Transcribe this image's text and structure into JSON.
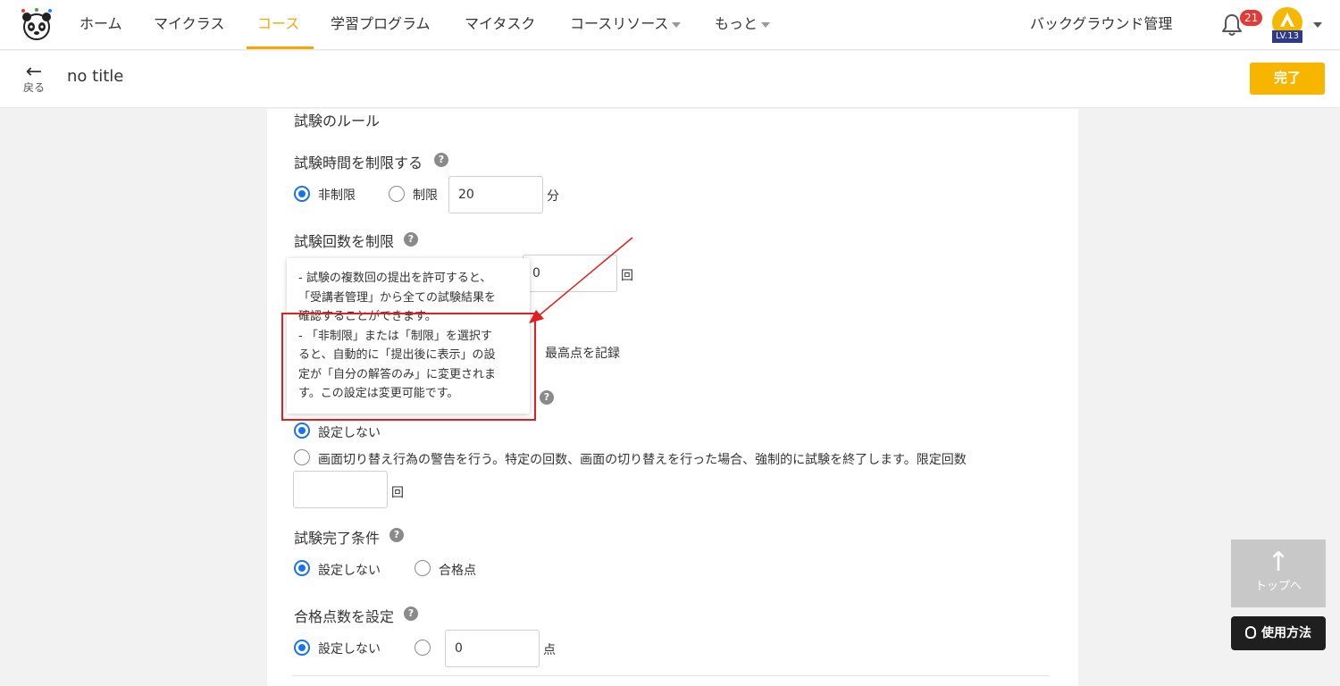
{
  "nav": {
    "items": [
      {
        "label": "ホーム"
      },
      {
        "label": "マイクラス"
      },
      {
        "label": "コース"
      },
      {
        "label": "学習プログラム"
      },
      {
        "label": "マイタスク"
      },
      {
        "label": "コースリソース"
      },
      {
        "label": "もっと"
      }
    ],
    "active_index": 2,
    "background_admin": "バックグラウンド管理",
    "notification_count": "21",
    "level": "LV.13",
    "accent_color": "#f7a600"
  },
  "subbar": {
    "back_label": "戻る",
    "title": "no title",
    "done_label": "完了"
  },
  "exam": {
    "section_title": "試験のルール",
    "time_limit": {
      "title": "試験時間を制限する",
      "option_unlimited": "非制限",
      "option_limited": "制限",
      "value": "20",
      "unit": "分"
    },
    "attempt_limit": {
      "title": "試験回数を制限",
      "value": "0",
      "unit": "回",
      "record_option": "最高点を記録"
    },
    "tooltip": {
      "text": "- 試験の複数回の提出を許可すると、\n「受講者管理」から全ての試験結果を\n確認することができます。\n- 「非制限」または「制限」を選択す\nると、自動的に「提出後に表示」の設\n定が「自分の解答のみ」に変更されま\nす。この設定は変更可能です。"
    },
    "screen_switch": {
      "option_none": "設定しない",
      "option_warn": "画面切り替え行為の警告を行う。特定の回数、画面の切り替えを行った場合、強制的に試験を終了します。限定回数",
      "value": "",
      "unit": "回"
    },
    "completion": {
      "title": "試験完了条件",
      "option_none": "設定しない",
      "option_pass": "合格点"
    },
    "pass_score": {
      "title": "合格点数を設定",
      "option_none": "設定しない",
      "value": "0",
      "unit": "点"
    }
  },
  "floating": {
    "to_top": "トップへ",
    "howto": "使用方法"
  }
}
